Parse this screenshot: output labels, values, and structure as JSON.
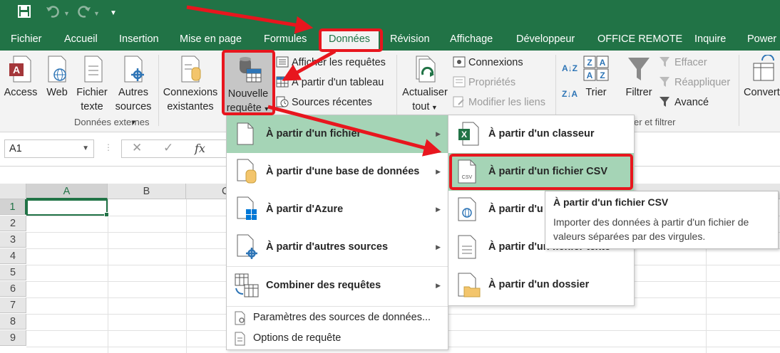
{
  "quick_access": {
    "icons": [
      "save-icon",
      "undo-icon",
      "redo-icon",
      "customize-icon"
    ]
  },
  "tabs": [
    "Fichier",
    "Accueil",
    "Insertion",
    "Mise en page",
    "Formules",
    "Données",
    "Révision",
    "Affichage",
    "Développeur",
    "OFFICE REMOTE",
    "Inquire",
    "Power"
  ],
  "active_tab": "Données",
  "ribbon": {
    "external": {
      "access": "Access",
      "web": "Web",
      "text_1": "Fichier",
      "text_2": "texte",
      "other_1": "Autres",
      "other_2": "sources",
      "group_label": "Données externes"
    },
    "connexions_existantes_1": "Connexions",
    "connexions_existantes_2": "existantes",
    "new_query_1": "Nouvelle",
    "new_query_2": "requête",
    "show_queries": "Afficher les requêtes",
    "from_table": "À partir d'un tableau",
    "recent_sources": "Sources récentes",
    "refresh_1": "Actualiser",
    "refresh_2": "tout",
    "connections": "Connexions",
    "properties": "Propriétés",
    "edit_links": "Modifier les liens",
    "sort": "Trier",
    "filter": "Filtrer",
    "clear": "Effacer",
    "reapply": "Réappliquer",
    "advanced": "Avancé",
    "sort_filter_label": "er et filtrer",
    "convert": "Convert"
  },
  "formula_bar": {
    "name_box": "A1",
    "fx": "fx"
  },
  "grid": {
    "columns": [
      "A",
      "B",
      "C"
    ],
    "rows": [
      "1",
      "2",
      "3",
      "4",
      "5",
      "6",
      "7",
      "8",
      "9"
    ]
  },
  "menu_main": {
    "items": [
      {
        "label": "À partir d'un fichier",
        "arrow": "▶"
      },
      {
        "label": "À partir d'une base de données",
        "arrow": "▶"
      },
      {
        "label": "À partir d'Azure",
        "arrow": "▶"
      },
      {
        "label": "À partir d'autres sources",
        "arrow": "▶"
      },
      {
        "label": "Combiner des requêtes",
        "arrow": "▶"
      }
    ],
    "settings": "Paramètres des sources de données...",
    "options": "Options de requête"
  },
  "menu_sub": {
    "items": [
      "À partir d'un classeur",
      "À partir d'un fichier CSV",
      "À partir d'u",
      "À partir d'un fichier texte",
      "À partir d'un dossier"
    ]
  },
  "tooltip": {
    "title": "À partir d'un fichier CSV",
    "description": "Importer des données à partir d'un fichier de valeurs séparées par des virgules."
  },
  "colors": {
    "excel_green": "#217346",
    "highlight": "#a5d4b6",
    "annotation_red": "#e8161e"
  }
}
